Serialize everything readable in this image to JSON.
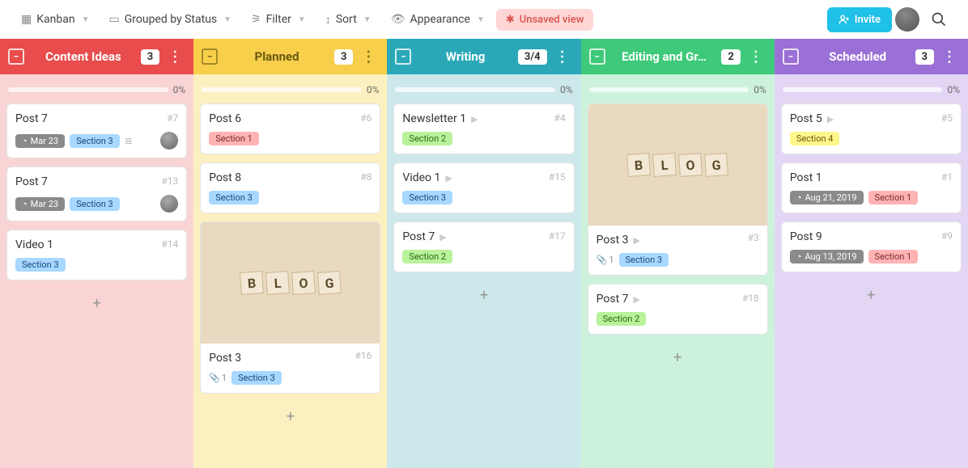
{
  "toolbar": {
    "view": "Kanban",
    "group": "Grouped by Status",
    "filter": "Filter",
    "sort": "Sort",
    "appearance": "Appearance",
    "unsaved": "Unsaved view",
    "invite": "Invite"
  },
  "columns": [
    {
      "key": "ideas",
      "title": "Content Ideas",
      "count": "3",
      "progress": "0%",
      "color": "c-red"
    },
    {
      "key": "planned",
      "title": "Planned",
      "count": "3",
      "progress": "0%",
      "color": "c-yel"
    },
    {
      "key": "writing",
      "title": "Writing",
      "count": "3/4",
      "progress": "0%",
      "color": "c-teal"
    },
    {
      "key": "editing",
      "title": "Editing and Gr…",
      "count": "2",
      "progress": "0%",
      "color": "c-grn"
    },
    {
      "key": "scheduled",
      "title": "Scheduled",
      "count": "3",
      "progress": "0%",
      "color": "c-pur"
    }
  ],
  "cards": {
    "ideas": [
      {
        "title": "Post 7",
        "num": "#7",
        "date": "Mar 23",
        "section": "Section 3",
        "sclass": "chip-s3",
        "desc": true,
        "avatar": true
      },
      {
        "title": "Post 7",
        "num": "#13",
        "date": "Mar 23",
        "section": "Section 3",
        "sclass": "chip-s3",
        "avatar": true
      },
      {
        "title": "Video 1",
        "num": "#14",
        "section": "Section 3",
        "sclass": "chip-s3"
      }
    ],
    "planned": [
      {
        "title": "Post 6",
        "num": "#6",
        "section": "Section 1",
        "sclass": "chip-s1"
      },
      {
        "title": "Post 8",
        "num": "#8",
        "section": "Section 3",
        "sclass": "chip-s3"
      },
      {
        "title": "Post 3",
        "num": "#16",
        "image": true,
        "attach": "1",
        "section": "Section 3",
        "sclass": "chip-s3"
      }
    ],
    "writing": [
      {
        "title": "Newsletter 1",
        "num": "#4",
        "play": true,
        "section": "Section 2",
        "sclass": "chip-s2"
      },
      {
        "title": "Video 1",
        "num": "#15",
        "play": true,
        "section": "Section 3",
        "sclass": "chip-s3"
      },
      {
        "title": "Post 7",
        "num": "#17",
        "play": true,
        "section": "Section 2",
        "sclass": "chip-s2"
      }
    ],
    "editing": [
      {
        "title": "Post 3",
        "num": "#3",
        "image": true,
        "play": true,
        "attach": "1",
        "section": "Section 3",
        "sclass": "chip-s3"
      },
      {
        "title": "Post 7",
        "num": "#18",
        "play": true,
        "section": "Section 2",
        "sclass": "chip-s2"
      }
    ],
    "scheduled": [
      {
        "title": "Post 5",
        "num": "#5",
        "play": true,
        "section": "Section 4",
        "sclass": "chip-s4"
      },
      {
        "title": "Post 1",
        "num": "#1",
        "date": "Aug 21, 2019",
        "section": "Section 1",
        "sclass": "chip-s1"
      },
      {
        "title": "Post 9",
        "num": "#9",
        "date": "Aug 13, 2019",
        "section": "Section 1",
        "sclass": "chip-s1"
      }
    ]
  }
}
